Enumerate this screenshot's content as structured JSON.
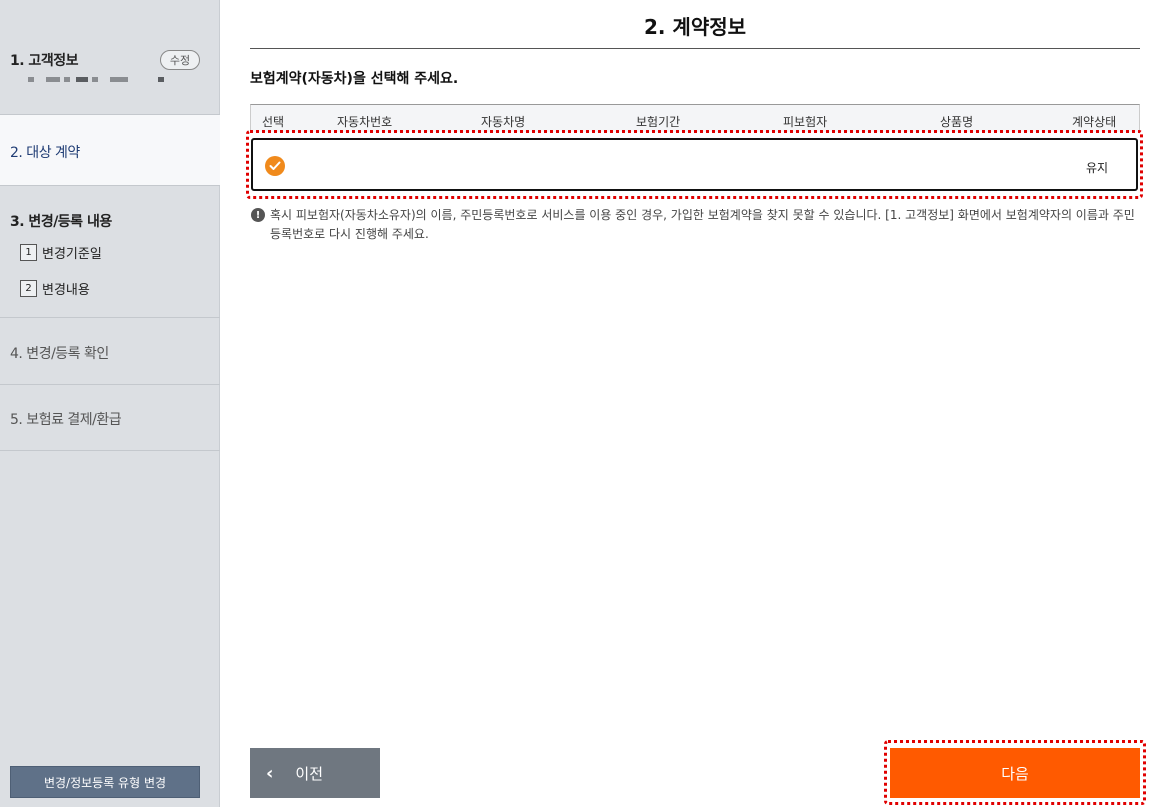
{
  "sidebar": {
    "step1": {
      "title": "1. 고객정보",
      "edit_label": "수정"
    },
    "step2": {
      "title": "2. 대상 계약"
    },
    "step3": {
      "title": "3. 변경/등록 내용",
      "items": [
        {
          "num": "1",
          "label": "변경기준일"
        },
        {
          "num": "2",
          "label": "변경내용"
        }
      ]
    },
    "step4": {
      "title": "4. 변경/등록 확인"
    },
    "step5": {
      "title": "5. 보험료 결제/환급"
    },
    "type_change_label": "변경/정보등록 유형 변경"
  },
  "main": {
    "title": "2. 계약정보",
    "instruction": "보험계약(자동차)을 선택해 주세요.",
    "table": {
      "headers": [
        "선택",
        "자동차번호",
        "자동차명",
        "보험기간",
        "피보험자",
        "상품명",
        "계약상태"
      ],
      "rows": [
        {
          "selected": true,
          "car_number": "",
          "car_name": "",
          "period": "",
          "insured": "",
          "product": "",
          "status": "유지"
        }
      ]
    },
    "notice": "혹시 피보험자(자동차소유자)의 이름, 주민등록번호로 서비스를 이용 중인 경우, 가입한 보험계약을 찾지 못할 수 있습니다. [1. 고객정보] 화면에서 보험계약자의 이름과 주민등록번호로 다시 진행해 주세요."
  },
  "buttons": {
    "prev": "이전",
    "next": "다음"
  },
  "colors": {
    "accent": "#ff5a00",
    "check": "#f08a1c",
    "highlight": "#e00000",
    "sidebar_bg": "#dcdfe3"
  }
}
